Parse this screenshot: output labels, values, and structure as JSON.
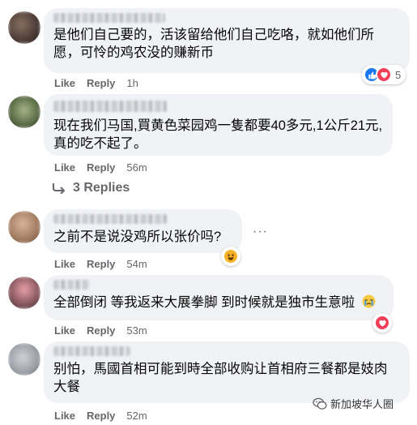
{
  "comments": [
    {
      "text": "是他们自己要的，活该留给他们自己吃咯，就如他们所愿，可怜的鸡农没的赚新币",
      "like": "Like",
      "reply": "Reply",
      "time": "1h",
      "reaction_count": "5"
    },
    {
      "text": "现在我们马国,買黄色菜园鸡一隻都要40多元,1公斤21元,真的吃不起了。",
      "like": "Like",
      "reply": "Reply",
      "time": "56m",
      "replies_label": "3 Replies"
    },
    {
      "text": "之前不是说没鸡所以张价吗?",
      "like": "Like",
      "reply": "Reply",
      "time": "54m",
      "more": "···"
    },
    {
      "text": "全部倒闭 等我返来大展拳脚 到时候就是独市生意啦",
      "like": "Like",
      "reply": "Reply",
      "time": "53m"
    },
    {
      "text": "别怕，馬國首相可能到時全部收购让首相府三餐都是妓肉大餐",
      "like": "Like",
      "reply": "Reply",
      "time": "52m"
    }
  ],
  "watermark": "新加坡华人圈",
  "colors": {
    "bubble": "#f0f2f5",
    "meta": "#65676b",
    "like_blue": "#1877f2",
    "love_red": "#f33e58",
    "haha_yellow": "#f7b125"
  }
}
